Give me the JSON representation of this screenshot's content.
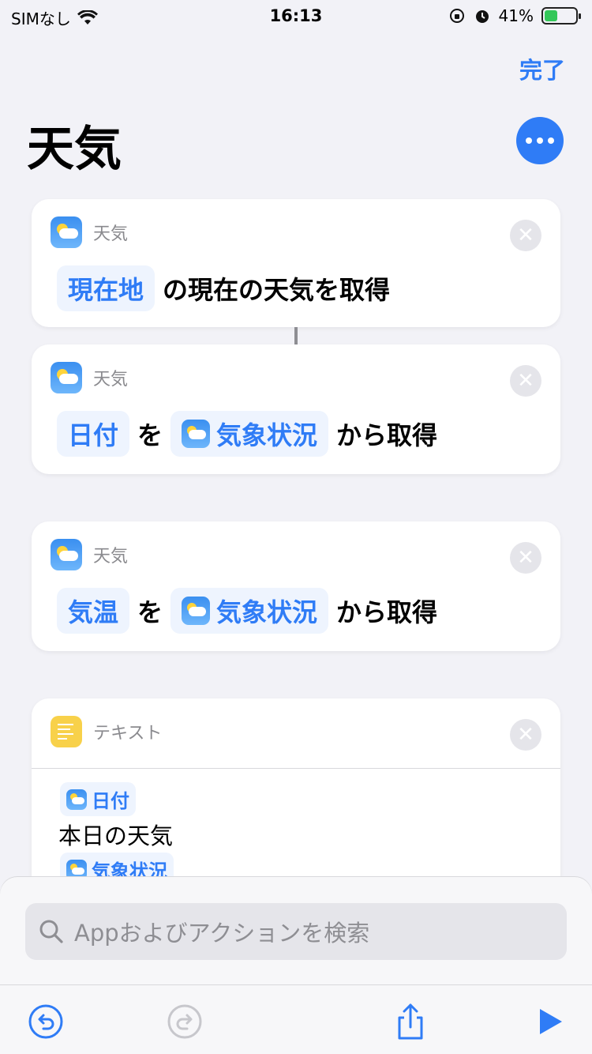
{
  "status_bar": {
    "carrier": "SIMなし",
    "time": "16:13",
    "battery_percent": "41%",
    "battery_level": 0.41
  },
  "header": {
    "done_label": "完了",
    "title": "天気"
  },
  "cards": [
    {
      "app_label": "天気",
      "param": "現在地",
      "text": "の現在の天気を取得"
    },
    {
      "app_label": "天気",
      "param": "日付",
      "joiner": "を",
      "source": "気象状況",
      "tail": "から取得"
    },
    {
      "app_label": "天気",
      "param": "気温",
      "joiner": "を",
      "source": "気象状況",
      "tail": "から取得"
    }
  ],
  "text_card": {
    "app_label": "テキスト",
    "token1": "日付",
    "line": "本日の天気",
    "token2": "気象状況"
  },
  "search": {
    "placeholder": "Appおよびアクションを検索"
  },
  "colors": {
    "accent": "#2f7cf6",
    "background": "#f2f2f7"
  }
}
